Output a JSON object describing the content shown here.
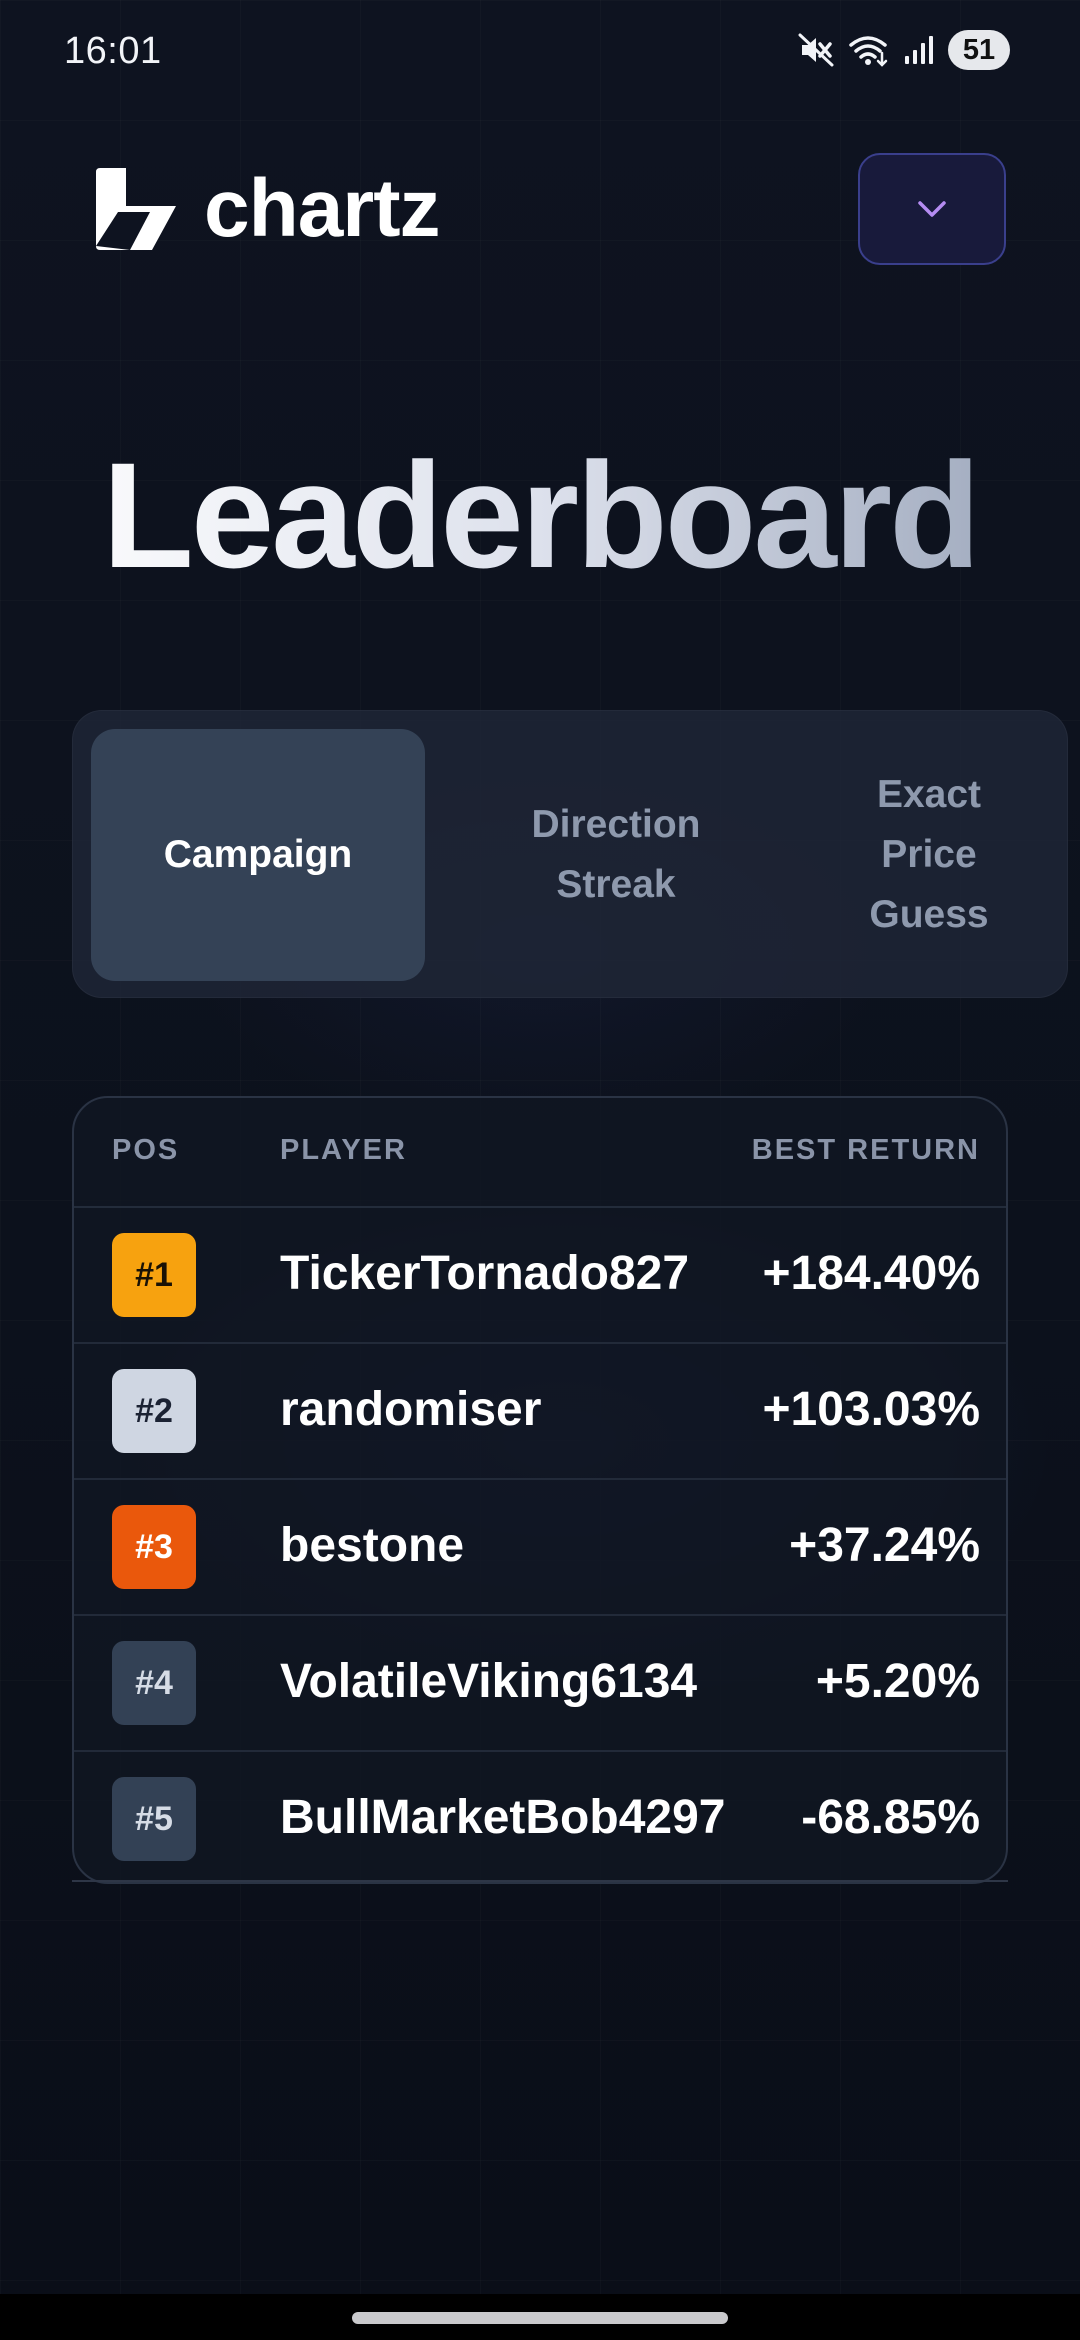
{
  "status_bar": {
    "time": "16:01",
    "battery": "51",
    "icons": [
      "mute-icon",
      "wifi-icon",
      "signal-icon",
      "battery-icon"
    ]
  },
  "header": {
    "brand": "chartz",
    "menu_icon": "chevron-down-icon",
    "accent_color": "#b58cf2"
  },
  "page": {
    "title": "Leaderboard"
  },
  "tabs": [
    {
      "label": "Campaign",
      "active": true
    },
    {
      "label": "Direction\nStreak",
      "active": false
    },
    {
      "label": "Exact\nPrice\nGuess",
      "active": false
    }
  ],
  "table": {
    "columns": {
      "pos": "POS",
      "player": "PLAYER",
      "return": "BEST RETURN"
    },
    "rows": [
      {
        "rank": "#1",
        "player": "TickerTornado827",
        "return": "+184.40%",
        "badge_bg": "#f7a20f",
        "badge_fg": "#1a1205"
      },
      {
        "rank": "#2",
        "player": "randomiser",
        "return": "+103.03%",
        "badge_bg": "#cfd6e2",
        "badge_fg": "#1b2233"
      },
      {
        "rank": "#3",
        "player": "bestone",
        "return": "+37.24%",
        "badge_bg": "#ea580c",
        "badge_fg": "#ffffff"
      },
      {
        "rank": "#4",
        "player": "VolatileViking6134",
        "return": "+5.20%",
        "badge_bg": "#334155",
        "badge_fg": "#d6dce6"
      },
      {
        "rank": "#5",
        "player": "BullMarketBob4297",
        "return": "-68.85%",
        "badge_bg": "#334155",
        "badge_fg": "#d6dce6"
      }
    ]
  }
}
